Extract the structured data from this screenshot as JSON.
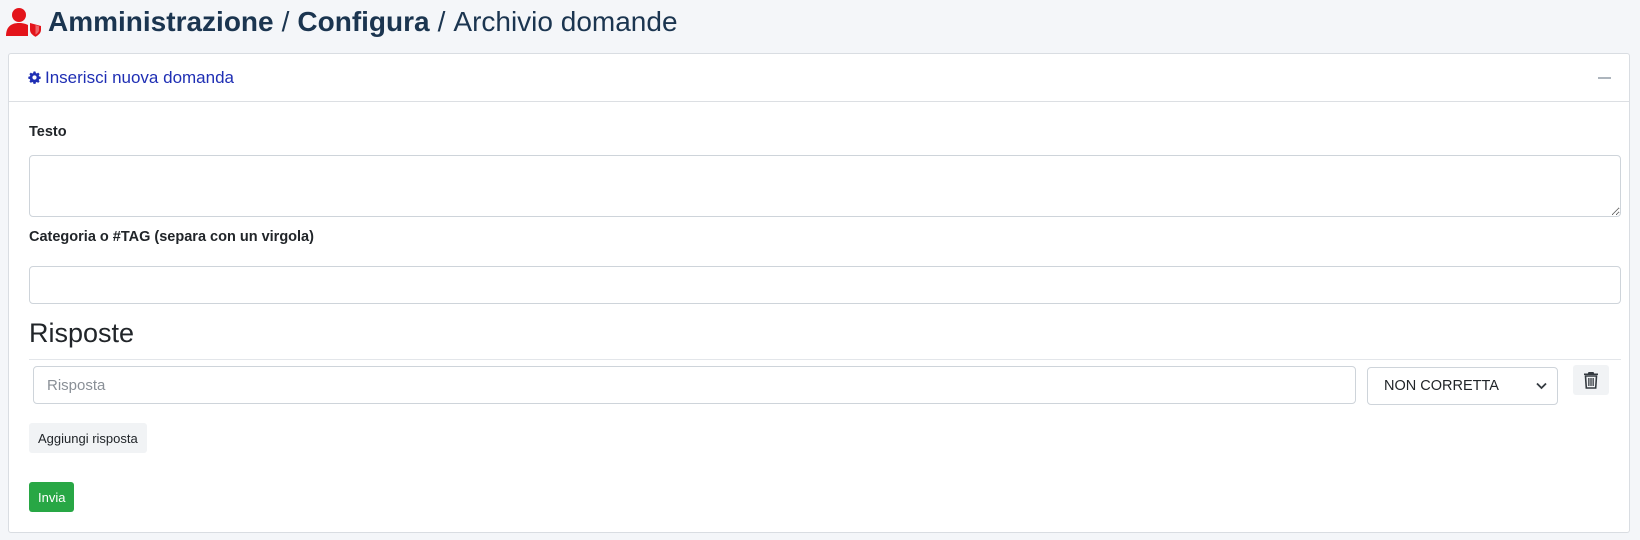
{
  "breadcrumb": {
    "icon": "user-shield-icon",
    "icon_color": "#e3141b",
    "item1": "Amministrazione",
    "sep1": "/",
    "item2": "Configura",
    "sep2": "/",
    "item3": "Archivio domande"
  },
  "card": {
    "icon": "gear-icon",
    "title": "Inserisci nuova domanda",
    "title_color": "#1f2fb4",
    "collapse_icon": "minus-icon"
  },
  "form": {
    "text_label": "Testo",
    "text_value": "",
    "tag_label": "Categoria o #TAG (separa con un virgola)",
    "tag_value": ""
  },
  "answers": {
    "section_title": "Risposte",
    "rows": [
      {
        "placeholder": "Risposta",
        "value": "",
        "correctness": "NON CORRETTA",
        "delete_icon": "trash-icon"
      }
    ],
    "add_label": "Aggiungi risposta"
  },
  "submit": {
    "label": "Invia",
    "color": "#28a745"
  }
}
